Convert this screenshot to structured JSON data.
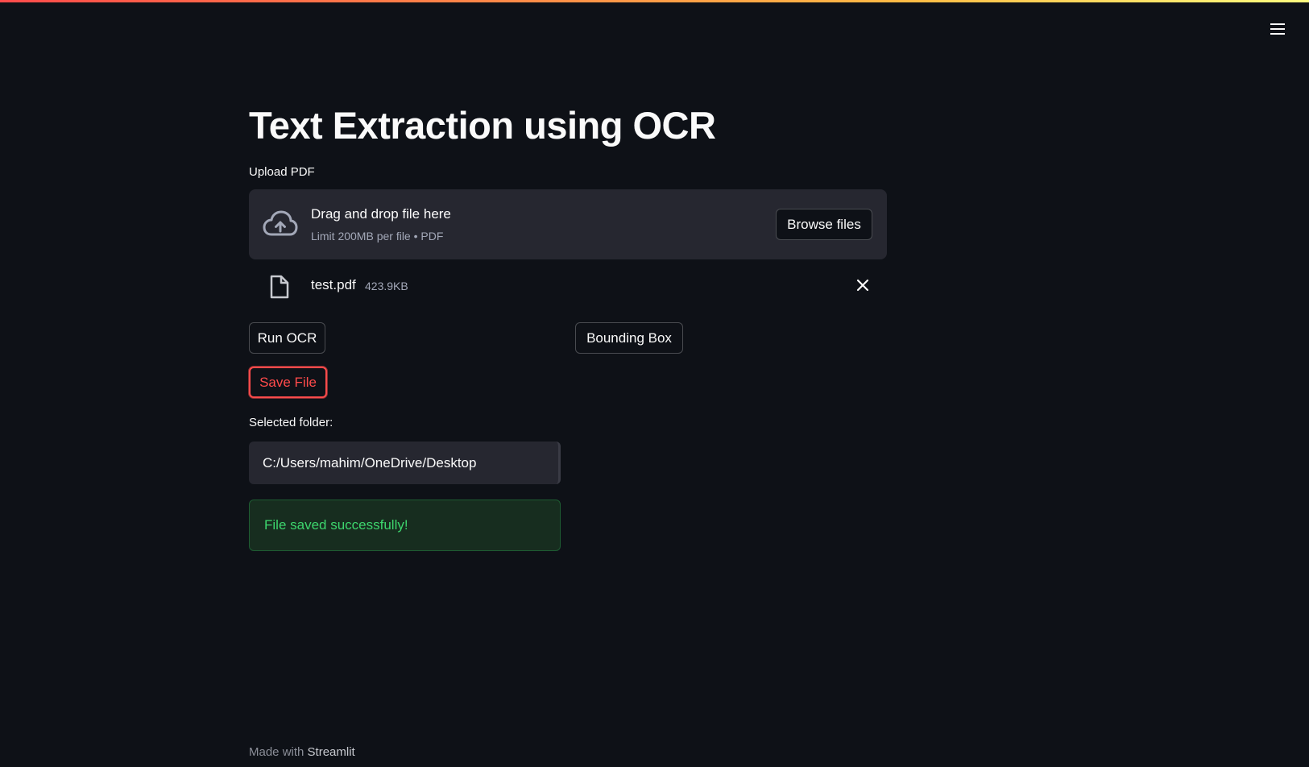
{
  "app": {
    "title": "Text Extraction using OCR"
  },
  "colors": {
    "background": "#0e1117",
    "accent": "#ff4b4b",
    "success_text": "#3dd56d",
    "success_bg": "#172d1f"
  },
  "header": {
    "menu_icon": "hamburger-menu-icon"
  },
  "uploader": {
    "label": "Upload PDF",
    "drop_title": "Drag and drop file here",
    "drop_limit": "Limit 200MB per file • PDF",
    "browse_label": "Browse files",
    "icon": "cloud-upload-icon"
  },
  "uploaded_file": {
    "name": "test.pdf",
    "size": "423.9KB",
    "icon": "file-icon",
    "remove_icon": "close-icon"
  },
  "buttons": {
    "run_ocr": "Run OCR",
    "bounding_box": "Bounding Box",
    "save_file": "Save File"
  },
  "folder": {
    "label": "Selected folder:",
    "value": "C:/Users/mahim/OneDrive/Desktop"
  },
  "status": {
    "success_message": "File saved successfully!"
  },
  "footer": {
    "prefix": "Made with",
    "brand": "Streamlit"
  }
}
